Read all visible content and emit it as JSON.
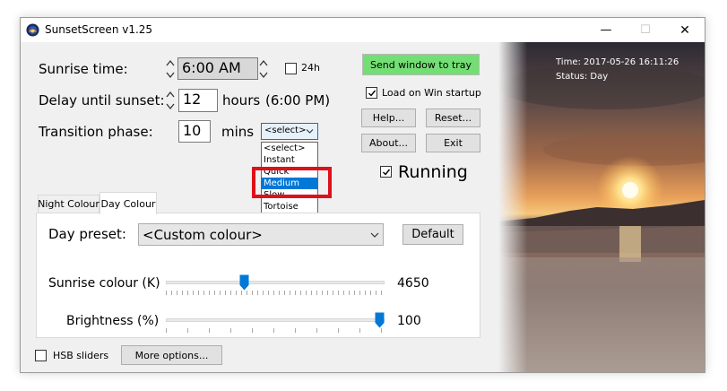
{
  "window": {
    "title": "SunsetScreen v1.25",
    "controls": {
      "minimize": "—",
      "maximize": "☐",
      "close": "✕"
    }
  },
  "timing": {
    "sunrise_label": "Sunrise time:",
    "sunrise_value": "6:00 AM",
    "format_24h_label": "24h",
    "format_24h_checked": false,
    "delay_label": "Delay until sunset:",
    "delay_value": "12",
    "delay_unit": "hours",
    "delay_result": "(6:00 PM)",
    "transition_label": "Transition phase:",
    "transition_value": "10",
    "transition_unit": "mins",
    "transition_select_value": "<select>",
    "transition_options": [
      "<select>",
      "Instant",
      "Quick",
      "Medium",
      "Slow",
      "Tortoise"
    ],
    "transition_highlighted": "Medium"
  },
  "actions": {
    "send_to_tray": "Send window to tray",
    "load_startup_label": "Load on Win startup",
    "load_startup_checked": true,
    "help": "Help...",
    "reset": "Reset...",
    "about": "About...",
    "exit": "Exit",
    "running_label": "Running",
    "running_checked": true
  },
  "tabs": [
    {
      "label": "Night Colour",
      "active": false
    },
    {
      "label": "Day Colour",
      "active": true
    }
  ],
  "day_colour": {
    "preset_label": "Day preset:",
    "preset_value": "<Custom colour>",
    "default_button": "Default",
    "sunrise_colour_label": "Sunrise colour (K)",
    "sunrise_colour_value": "4650",
    "sunrise_colour_fraction": 0.35,
    "brightness_label": "Brightness (%)",
    "brightness_value": "100",
    "brightness_fraction": 1.0
  },
  "bottom": {
    "hsb_label": "HSB sliders",
    "hsb_checked": false,
    "more_options": "More options..."
  },
  "status": {
    "time": "Time: 2017-05-26 16:11:26",
    "state": "Status: Day"
  },
  "colors": {
    "send_button_bg": "#73de73",
    "highlight_box": "#e0101a",
    "slider_thumb": "#0078d7",
    "selection": "#0078d7"
  },
  "icons": {
    "app": "sunset-app-icon",
    "spin": "spin-arrows-icon",
    "dropdown": "chevron-down-icon",
    "checkbox": "checkmark-icon"
  }
}
